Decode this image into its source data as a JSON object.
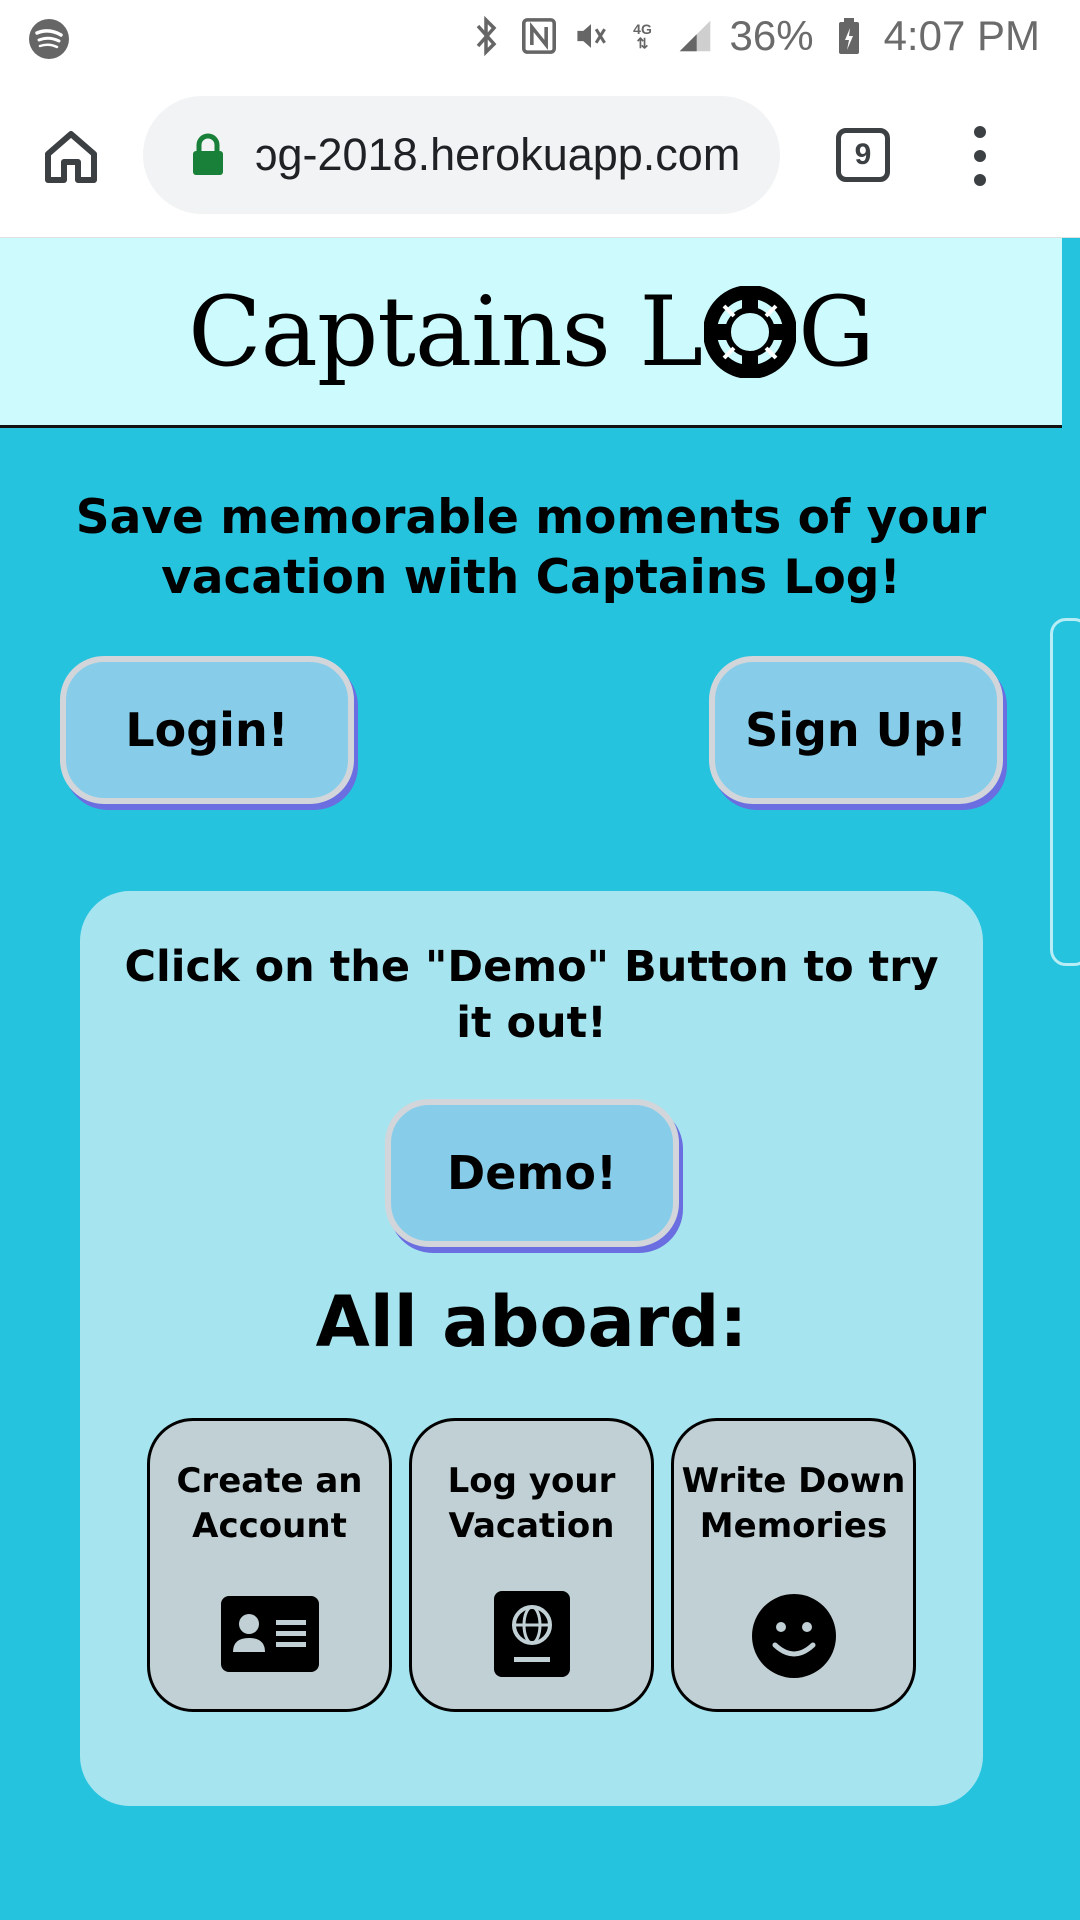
{
  "status_bar": {
    "battery": "36%",
    "time": "4:07 PM",
    "icons": [
      "spotify-icon",
      "bluetooth-icon",
      "nfc-icon",
      "vibrate-mute-icon",
      "lte-icon",
      "signal-icon",
      "battery-icon"
    ]
  },
  "browser": {
    "url": "ɔg-2018.herokuapp.com",
    "tab_count": "9"
  },
  "page": {
    "brand_part1": "Captains L",
    "brand_part2": "G",
    "tagline": "Save memorable moments of your vacation with Captains Log!",
    "login_label": "Login!",
    "signup_label": "Sign Up!",
    "demo_prompt": "Click on the \"Demo\" Button to try it out!",
    "demo_label": "Demo!",
    "all_aboard": "All aboard:",
    "features": [
      {
        "label": "Create an Account",
        "icon": "id-card-icon"
      },
      {
        "label": "Log your Vacation",
        "icon": "passport-icon"
      },
      {
        "label": "Write Down Memories",
        "icon": "smile-icon"
      }
    ]
  },
  "colors": {
    "page_bg": "#26c3df",
    "header_bg": "#ccfafd",
    "panel_bg": "#a6e4ef",
    "button_bg": "#87cde9",
    "card_bg": "#c1d0d5"
  }
}
